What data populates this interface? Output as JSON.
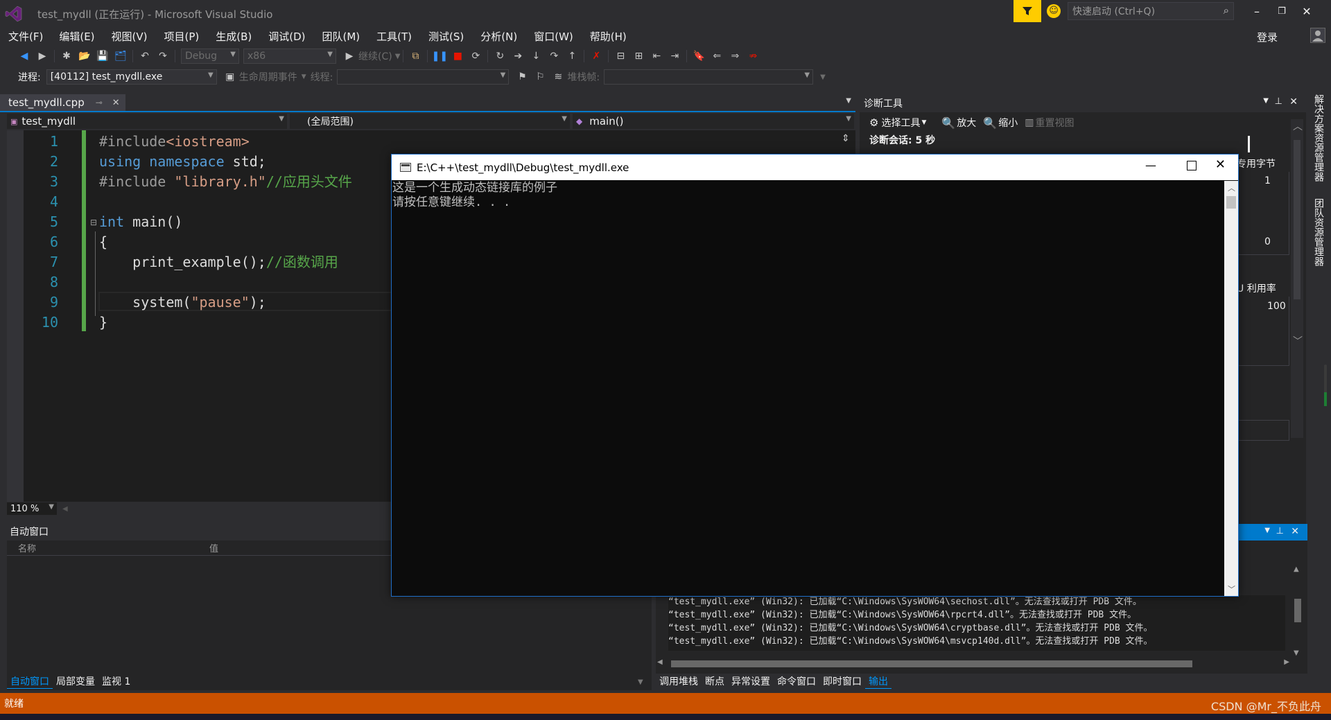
{
  "title_bar": {
    "window_title": "test_mydll (正在运行) - Microsoft Visual Studio",
    "quick_launch_placeholder": "快速启动 (Ctrl+Q)",
    "sign_in": "登录"
  },
  "menu": [
    "文件(F)",
    "编辑(E)",
    "视图(V)",
    "项目(P)",
    "生成(B)",
    "调试(D)",
    "团队(M)",
    "工具(T)",
    "测试(S)",
    "分析(N)",
    "窗口(W)",
    "帮助(H)"
  ],
  "toolbar": {
    "config": "Debug",
    "platform": "x86",
    "continue_label": "继续(C)"
  },
  "debug_bar": {
    "process_label": "进程:",
    "process_value": "[40112] test_mydll.exe",
    "lifecycle_label": "生命周期事件",
    "thread_label": "线程:",
    "stackframe_label": "堆栈帧:"
  },
  "editor": {
    "tab_name": "test_mydll.cpp",
    "nav_project": "test_mydll",
    "nav_scope": "(全局范围)",
    "nav_member": "main()",
    "zoom": "110 %",
    "line_numbers": [
      "1",
      "2",
      "3",
      "4",
      "5",
      "6",
      "7",
      "8",
      "9",
      "10"
    ],
    "code": {
      "l1_a": "#include",
      "l1_b": "<iostream>",
      "l2_a": "using",
      "l2_b": "namespace",
      "l2_c": " std;",
      "l3_a": "#include ",
      "l3_b": "\"library.h\"",
      "l3_c": "//应用头文件",
      "l5_a": "int",
      "l5_b": " main()",
      "l6": "{",
      "l7_a": "    print_example();",
      "l7_b": "//函数调用",
      "l9_a": "    system(",
      "l9_b": "\"pause\"",
      "l9_c": ");",
      "l10": "}"
    }
  },
  "diagnostics": {
    "title": "诊断工具",
    "select_tool": "选择工具",
    "zoom_in": "放大",
    "zoom_out": "缩小",
    "reset_view": "重置视图",
    "session": "诊断会话: 5 秒",
    "private_bytes": "专用字节",
    "val_1": "1",
    "val_0": "0",
    "cpu_label": "U 利用率",
    "val_100": "100"
  },
  "console": {
    "title": "E:\\C++\\test_mydll\\Debug\\test_mydll.exe",
    "line1": "这是一个生成动态链接库的例子",
    "line2": "请按任意键继续. . ."
  },
  "autos": {
    "title": "自动窗口",
    "col_name": "名称",
    "col_value": "值",
    "tabs": [
      "自动窗口",
      "局部变量",
      "监视 1"
    ]
  },
  "output": {
    "lines": [
      "“test_mydll.exe” (Win32): 已加载“C:\\Windows\\SysWOW64\\sechost.dll”。无法查找或打开 PDB 文件。",
      "“test_mydll.exe” (Win32): 已加载“C:\\Windows\\SysWOW64\\rpcrt4.dll”。无法查找或打开 PDB 文件。",
      "“test_mydll.exe” (Win32): 已加载“C:\\Windows\\SysWOW64\\cryptbase.dll”。无法查找或打开 PDB 文件。",
      "“test_mydll.exe” (Win32): 已加载“C:\\Windows\\SysWOW64\\msvcp140d.dll”。无法查找或打开 PDB 文件。"
    ],
    "tabs": [
      "调用堆栈",
      "断点",
      "异常设置",
      "命令窗口",
      "即时窗口",
      "输出"
    ]
  },
  "side_tabs": [
    "解决方案资源管理器",
    "团队资源管理器"
  ],
  "status": {
    "text": "就绪",
    "watermark": "CSDN @Mr_不负此舟"
  },
  "colors": {
    "vs_bg": "#2d2d30",
    "editor_bg": "#1e1e1e",
    "status_bar": "#ca5100",
    "accent": "#007acc",
    "keyword": "#569cd6",
    "string": "#d69d85",
    "comment": "#57a64a",
    "line_number": "#2b91af"
  }
}
